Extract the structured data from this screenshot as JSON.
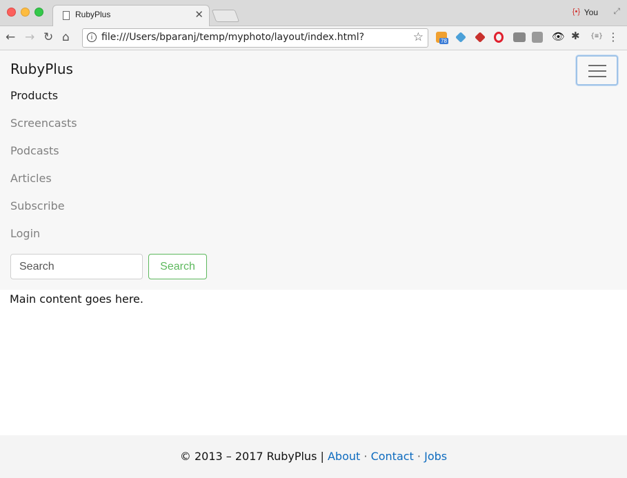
{
  "browser": {
    "tab_title": "RubyPlus",
    "profile_name": "You",
    "profile_icon": "{•}",
    "url": "file:///Users/bparanj/temp/myphoto/layout/index.html?",
    "rss_badge": "78",
    "ext_json_label": "{≡}"
  },
  "navbar": {
    "brand": "RubyPlus",
    "links": [
      "Products",
      "Screencasts",
      "Podcasts",
      "Articles",
      "Subscribe",
      "Login"
    ],
    "search_placeholder": "Search",
    "search_button": "Search"
  },
  "main": {
    "text": "Main content goes here."
  },
  "footer": {
    "copyright": "© 2013 – 2017 RubyPlus |",
    "about": "About",
    "contact": "Contact",
    "jobs": "Jobs",
    "separator": "·"
  },
  "colors": {
    "navbar_bg": "#f7f7f7",
    "link_blue": "#0d6bbf",
    "success_green": "#5cb85c",
    "nav_muted": "#808080"
  }
}
